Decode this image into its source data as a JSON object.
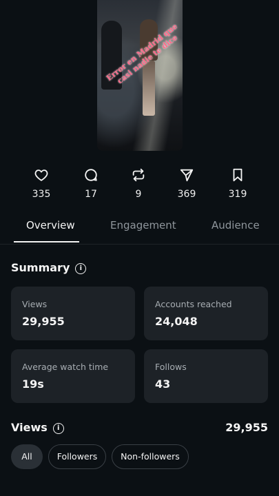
{
  "thumbnail": {
    "overlay_text": "Error en Madrid que casi nadie te dice"
  },
  "stats": {
    "likes": "335",
    "comments": "17",
    "reposts": "9",
    "shares": "369",
    "saves": "319"
  },
  "tabs": [
    {
      "label": "Overview",
      "active": true
    },
    {
      "label": "Engagement",
      "active": false
    },
    {
      "label": "Audience",
      "active": false
    }
  ],
  "summary": {
    "title": "Summary",
    "cards": [
      {
        "label": "Views",
        "value": "29,955"
      },
      {
        "label": "Accounts reached",
        "value": "24,048"
      },
      {
        "label": "Average watch time",
        "value": "19s"
      },
      {
        "label": "Follows",
        "value": "43"
      }
    ]
  },
  "views": {
    "title": "Views",
    "total": "29,955",
    "filters": [
      {
        "label": "All",
        "active": true
      },
      {
        "label": "Followers",
        "active": false
      },
      {
        "label": "Non-followers",
        "active": false
      }
    ]
  },
  "icons": {
    "info": "i",
    "like": "heart-icon",
    "comment": "comment-icon",
    "repost": "repost-icon",
    "share": "send-icon",
    "save": "bookmark-icon"
  },
  "colors": {
    "background": "#0b1014",
    "card": "#1d2227",
    "text": "#f5f5f5",
    "muted": "#8f969c"
  }
}
